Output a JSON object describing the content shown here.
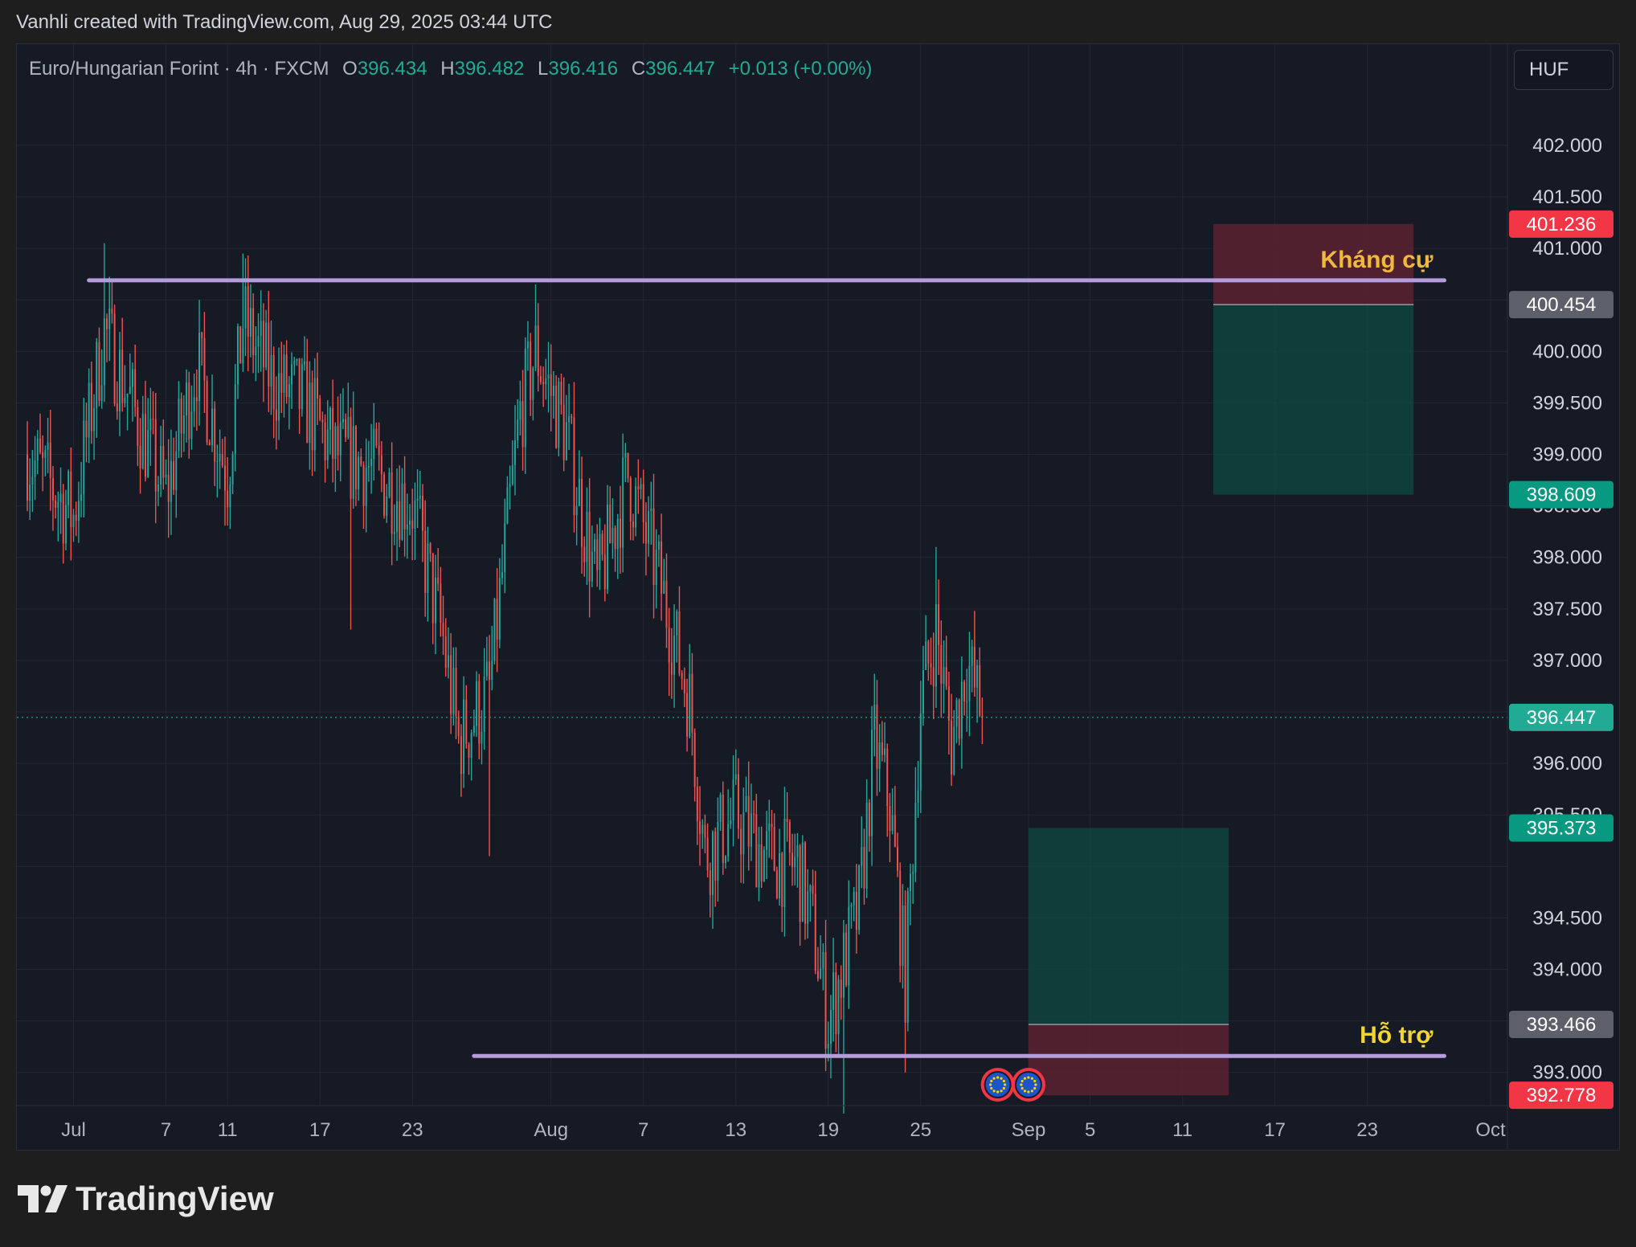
{
  "header": {
    "credit": "Vanhli created with TradingView.com, Aug 29, 2025 03:44 UTC"
  },
  "legend": {
    "symbol": "Euro/Hungarian Forint · 4h · FXCM",
    "o_label": "O",
    "o_value": "396.434",
    "h_label": "H",
    "h_value": "396.482",
    "l_label": "L",
    "l_value": "396.416",
    "c_label": "C",
    "c_value": "396.447",
    "change": "+0.013 (+0.00%)"
  },
  "currency_button": "HUF",
  "brand": {
    "name": "TradingView",
    "logo_icon": "tradingview-logo-icon"
  },
  "chart_data": {
    "type": "candlestick",
    "interval": "4h",
    "x_axis": {
      "type": "date",
      "range": [
        "2025-06-28",
        "2025-10-01"
      ],
      "ticks": [
        {
          "date": "2025-07-01",
          "label": "Jul"
        },
        {
          "date": "2025-07-07",
          "label": "7"
        },
        {
          "date": "2025-07-11",
          "label": "11"
        },
        {
          "date": "2025-07-17",
          "label": "17"
        },
        {
          "date": "2025-07-23",
          "label": "23"
        },
        {
          "date": "2025-08-01",
          "label": "Aug"
        },
        {
          "date": "2025-08-07",
          "label": "7"
        },
        {
          "date": "2025-08-13",
          "label": "13"
        },
        {
          "date": "2025-08-19",
          "label": "19"
        },
        {
          "date": "2025-08-25",
          "label": "25"
        },
        {
          "date": "2025-09-01",
          "label": "Sep"
        },
        {
          "date": "2025-09-05",
          "label": "5"
        },
        {
          "date": "2025-09-11",
          "label": "11"
        },
        {
          "date": "2025-09-17",
          "label": "17"
        },
        {
          "date": "2025-09-23",
          "label": "23"
        },
        {
          "date": "2025-10-01",
          "label": "Oct"
        }
      ]
    },
    "y_axis": {
      "range": [
        392.6,
        402.6
      ],
      "position": "right",
      "ticks": [
        "402.000",
        "401.500",
        "401.000",
        "400.000",
        "399.500",
        "399.000",
        "398.000",
        "397.500",
        "397.000",
        "396.000",
        "394.500",
        "394.000",
        "393.000"
      ],
      "partially_hidden_ticks": [
        "398.500",
        "395.500"
      ]
    },
    "grid": true,
    "colors": {
      "up": "#26a69a",
      "down": "#ef5350",
      "level_line": "#b39ddb",
      "profit": "#0d4a42",
      "loss": "#5b2230"
    },
    "ohlc_path": [
      [
        "2025-06-28",
        399.0
      ],
      [
        "2025-07-01",
        398.4
      ],
      [
        "2025-07-03",
        400.2
      ],
      [
        "2025-07-05",
        399.4
      ],
      [
        "2025-07-07",
        398.6
      ],
      [
        "2025-07-09",
        399.9
      ],
      [
        "2025-07-11",
        398.8
      ],
      [
        "2025-07-12",
        400.3
      ],
      [
        "2025-07-14",
        399.7
      ],
      [
        "2025-07-16",
        399.5
      ],
      [
        "2025-07-18",
        399.0
      ],
      [
        "2025-07-20",
        398.9
      ],
      [
        "2025-07-23",
        398.5
      ],
      [
        "2025-07-25",
        397.2
      ],
      [
        "2025-07-26",
        396.2
      ],
      [
        "2025-07-28",
        396.7
      ],
      [
        "2025-07-30",
        399.4
      ],
      [
        "2025-07-31",
        400.0
      ],
      [
        "2025-08-02",
        399.2
      ],
      [
        "2025-08-04",
        397.7
      ],
      [
        "2025-08-06",
        398.8
      ],
      [
        "2025-08-08",
        397.8
      ],
      [
        "2025-08-10",
        396.6
      ],
      [
        "2025-08-11",
        395.1
      ],
      [
        "2025-08-13",
        395.5
      ],
      [
        "2025-08-15",
        395.1
      ],
      [
        "2025-08-17",
        395.0
      ],
      [
        "2025-08-18",
        394.4
      ],
      [
        "2025-08-19",
        393.5
      ],
      [
        "2025-08-21",
        394.6
      ],
      [
        "2025-08-22",
        396.2
      ],
      [
        "2025-08-23",
        395.6
      ],
      [
        "2025-08-24",
        393.9
      ],
      [
        "2025-08-25",
        396.6
      ],
      [
        "2025-08-26",
        397.3
      ],
      [
        "2025-08-27",
        396.2
      ],
      [
        "2025-08-28",
        397.0
      ],
      [
        "2025-08-29",
        396.45
      ]
    ],
    "swing_extremes": [
      {
        "date": "2025-07-03",
        "high": 401.05
      },
      {
        "date": "2025-07-12",
        "high": 400.95
      },
      {
        "date": "2025-07-19",
        "low": 397.3
      },
      {
        "date": "2025-07-28",
        "low": 395.1
      },
      {
        "date": "2025-07-31",
        "high": 400.65
      },
      {
        "date": "2025-08-20",
        "low": 392.6
      },
      {
        "date": "2025-08-24",
        "low": 393.0
      },
      {
        "date": "2025-08-26",
        "high": 398.1
      }
    ],
    "last_price": 396.447,
    "levels": [
      {
        "name": "Kháng cự",
        "price": 400.69,
        "from": "2025-07-02",
        "to": "2025-09-28"
      },
      {
        "name": "Hỗ trợ",
        "price": 393.16,
        "from": "2025-07-27",
        "to": "2025-09-28"
      }
    ],
    "positions": [
      {
        "kind": "short",
        "from": "2025-09-13",
        "to": "2025-09-26",
        "stop": 401.236,
        "entry": 400.454,
        "target": 398.609
      },
      {
        "kind": "long",
        "from": "2025-09-01",
        "to": "2025-09-14",
        "stop": 392.778,
        "entry": 393.466,
        "target": 395.373
      }
    ],
    "price_tags": [
      {
        "value": "401.236",
        "color": "#f23645"
      },
      {
        "value": "400.454",
        "color": "#5d606b"
      },
      {
        "value": "398.609",
        "color": "#089981"
      },
      {
        "value": "396.447",
        "color": "#22ab94"
      },
      {
        "value": "395.373",
        "color": "#089981"
      },
      {
        "value": "393.466",
        "color": "#5d606b"
      },
      {
        "value": "392.778",
        "color": "#f23645"
      }
    ],
    "events": [
      {
        "date": "2025-08-30",
        "icon": "eu-flag-icon"
      },
      {
        "date": "2025-09-01",
        "icon": "eu-flag-icon"
      }
    ]
  }
}
